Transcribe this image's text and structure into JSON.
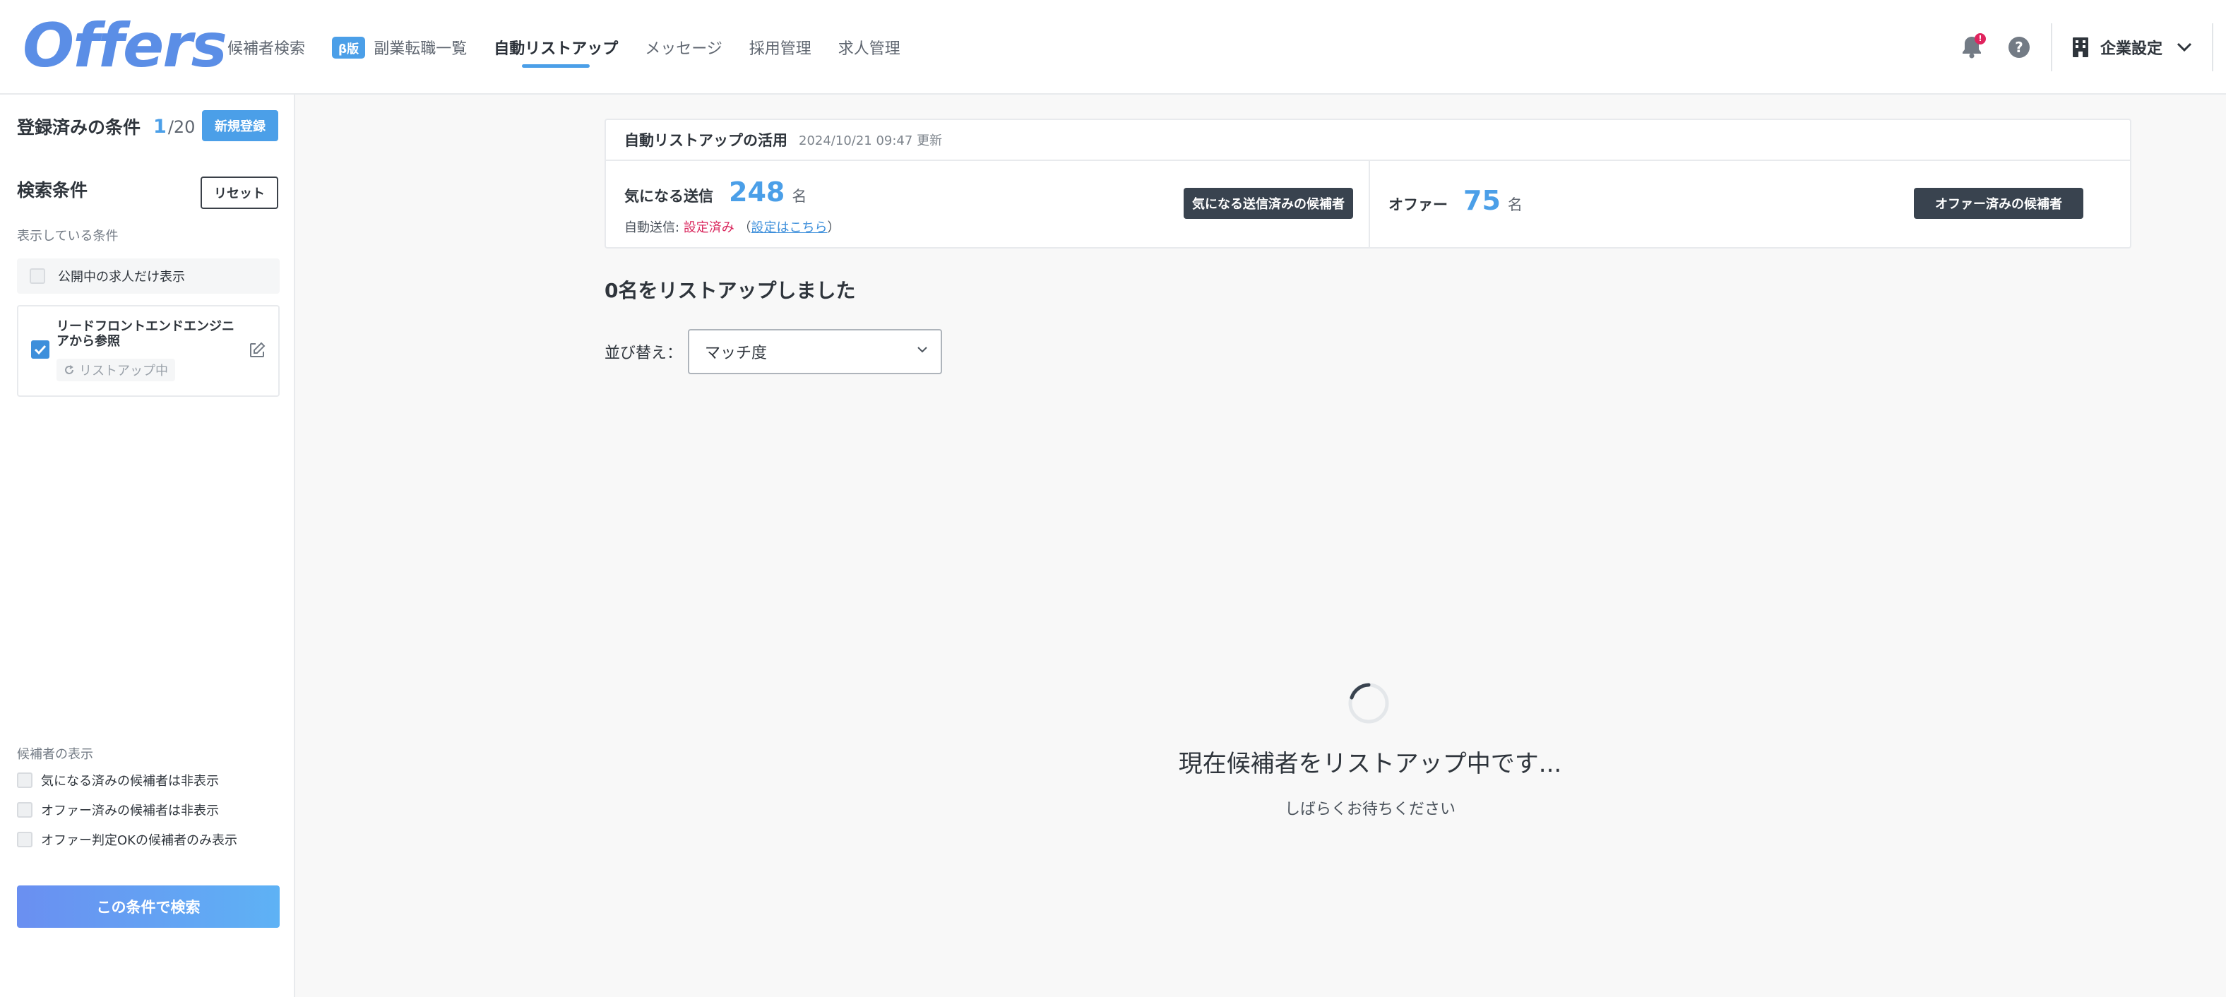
{
  "header": {
    "logo": "Offers",
    "nav": [
      {
        "label": "候補者検索"
      },
      {
        "badge": "β版",
        "label": "副業転職一覧"
      },
      {
        "label": "自動リストアップ"
      },
      {
        "label": "メッセージ"
      },
      {
        "label": "採用管理"
      },
      {
        "label": "求人管理"
      }
    ],
    "notification_count": "!",
    "help": "?",
    "corp_settings": "企業設定"
  },
  "sidebar": {
    "registered_title": "登録済みの条件",
    "registered_current": "1",
    "registered_total": "/20",
    "new_button": "新規登録",
    "search_conditions_title": "検索条件",
    "reset_button": "リセット",
    "shown_conditions_label": "表示している条件",
    "public_only_label": "公開中の求人だけ表示",
    "condition": {
      "name": "リードフロントエンドエンジニアから参照",
      "status": "リストアップ中"
    },
    "display_title": "候補者の表示",
    "display_options": [
      "気になる済みの候補者は非表示",
      "オファー済みの候補者は非表示",
      "オファー判定OKの候補者のみ表示"
    ],
    "search_button": "この条件で検索"
  },
  "summary": {
    "title": "自動リストアップの活用",
    "updated": "2024/10/21 09:47 更新",
    "interest_label": "気になる送信",
    "interest_count": "248",
    "unit": "名",
    "auto_send_label": "自動送信:",
    "auto_send_status": "設定済み",
    "paren_open": "（",
    "settings_link": "設定はこちら",
    "paren_close": "）",
    "interest_button": "気になる送信済みの候補者",
    "offer_label": "オファー",
    "offer_count": "75",
    "offer_button": "オファー済みの候補者"
  },
  "main": {
    "listed_text": "0名をリストアップしました",
    "sort_label": "並び替え：",
    "sort_value": "マッチ度",
    "loading_text": "現在候補者をリストアップ中です...",
    "waiting_text": "しばらくお待ちください"
  }
}
